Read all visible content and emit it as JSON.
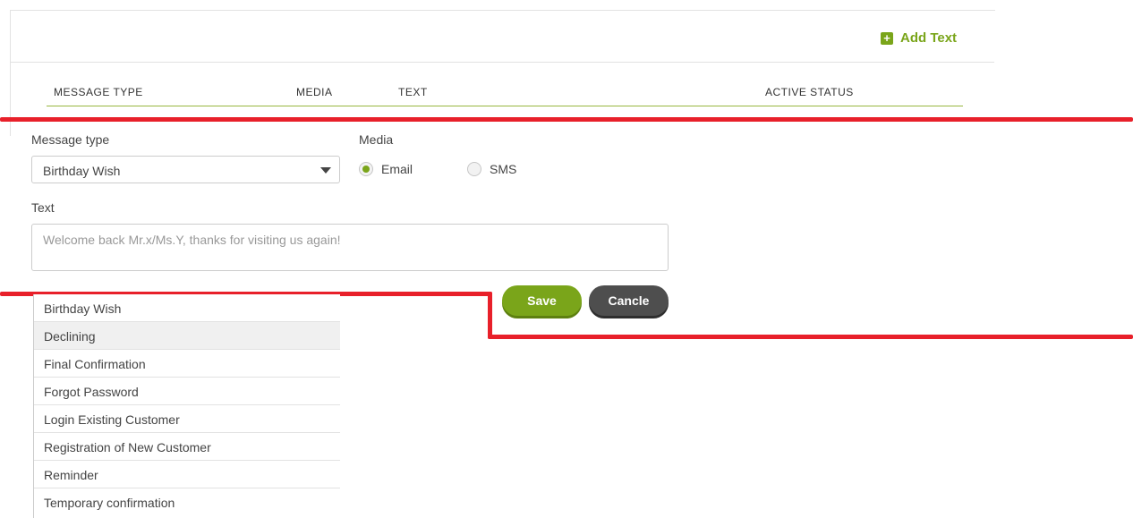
{
  "header": {
    "add_text_label": "Add Text"
  },
  "table": {
    "columns": [
      "MESSAGE TYPE",
      "MEDIA",
      "TEXT",
      "ACTIVE STATUS"
    ]
  },
  "form": {
    "message_type_label": "Message type",
    "message_type_value": "Birthday Wish",
    "media_label": "Media",
    "media_options": [
      {
        "label": "Email",
        "selected": true
      },
      {
        "label": "SMS",
        "selected": false
      }
    ],
    "text_label": "Text",
    "text_placeholder": "Welcome back Mr.x/Ms.Y, thanks for visiting us again!",
    "save_label": "Save",
    "cancel_label": "Cancle"
  },
  "dropdown": {
    "options": [
      "Birthday Wish",
      "Declining",
      "Final Confirmation",
      "Forgot Password",
      "Login Existing Customer",
      "Registration of New Customer",
      "Reminder",
      "Temporary confirmation"
    ],
    "highlighted": "Declining"
  },
  "colors": {
    "accent": "#7aa51a",
    "annotation_red": "#e8202a",
    "cancel_gray": "#4e4e4e"
  }
}
